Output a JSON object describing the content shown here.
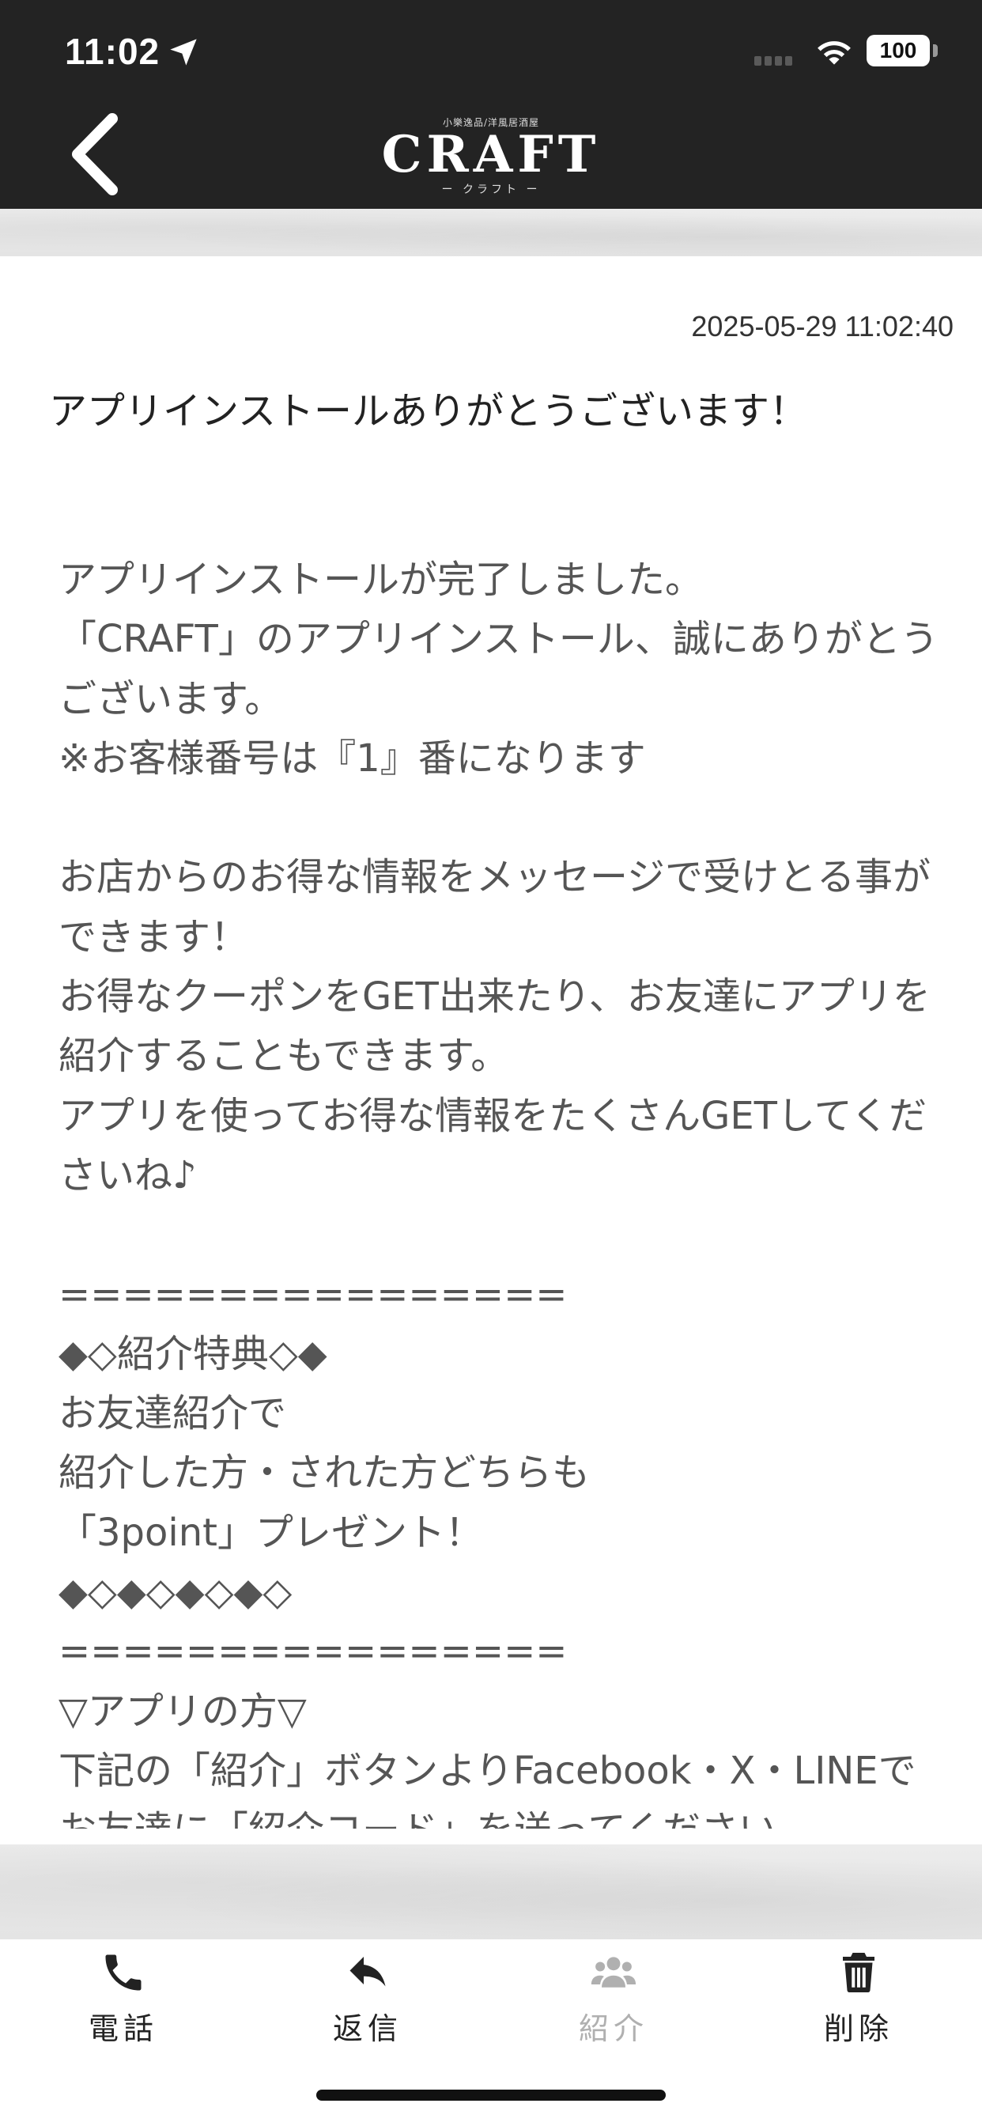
{
  "status_bar": {
    "time": "11:02",
    "battery": "100"
  },
  "header": {
    "logo_top": "小樂逸品/洋風居酒屋",
    "logo_main": "CRAFT",
    "logo_sub": "ー クラフト ー"
  },
  "message": {
    "date": "2025-05-29 11:02:40",
    "title": "アプリインストールありがとうございます！",
    "body": "アプリインストールが完了しました。\n「CRAFT」のアプリインストール、誠にありがとうございます。\n※お客様番号は『1』番になります\n\nお店からのお得な情報をメッセージで受けとる事ができます！\nお得なクーポンをGET出来たり、お友達にアプリを紹介することもできます。\nアプリを使ってお得な情報をたくさんGETしてくださいね♪\n\n================\n◆◇紹介特典◇◆\nお友達紹介で\n紹介した方・された方どちらも\n「3point」プレゼント！\n◆◇◆◇◆◇◆◇\n================\n▽アプリの方▽\n下記の「紹介」ボタンよりFacebook・X・LINEでお友達に「紹介コード」を送ってください"
  },
  "toolbar": {
    "phone_label": "電話",
    "reply_label": "返信",
    "share_label": "紹介",
    "delete_label": "削除"
  },
  "icons": {
    "back": "chevron-left-icon",
    "phone": "phone-icon",
    "reply": "reply-icon",
    "share": "users-icon",
    "delete": "trash-icon"
  },
  "colors": {
    "header_bg": "#232323",
    "disabled": "#b0b0b0"
  }
}
